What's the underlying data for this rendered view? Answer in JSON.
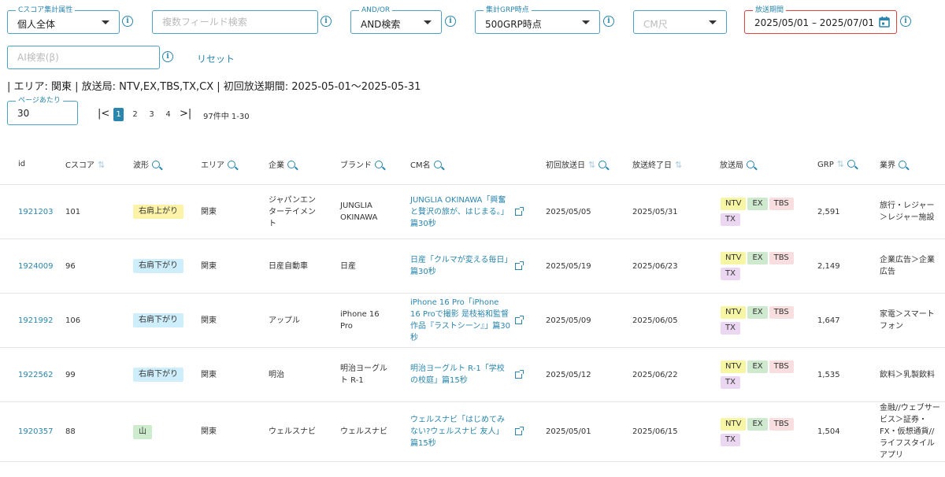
{
  "filters": {
    "score_attr": {
      "label": "Cスコア集計属性",
      "value": "個人全体"
    },
    "multi_search": {
      "placeholder": "複数フィールド検索"
    },
    "and_or": {
      "label": "AND/OR",
      "value": "AND検索"
    },
    "grp_point": {
      "label": "集計GRP時点",
      "value": "500GRP時点"
    },
    "cm_length": {
      "placeholder": "CM尺"
    },
    "period": {
      "label": "放送期間",
      "value": "2025/05/01 – 2025/07/01"
    },
    "ai_search": {
      "placeholder": "AI検索(β)"
    },
    "reset_label": "リセット",
    "info_glyph": "i"
  },
  "filter_summary": "| エリア: 関東 | 放送局: NTV,EX,TBS,TX,CX | 初回放送期間: 2025-05-01〜2025-05-31",
  "pagination": {
    "per_page_label": "ページあたり",
    "per_page_value": "30",
    "first_glyph": "|<",
    "last_glyph": ">|",
    "pages": [
      "1",
      "2",
      "3",
      "4"
    ],
    "active_page": "1",
    "info": "97件中 1-30"
  },
  "table": {
    "headers": {
      "id": "id",
      "cscore": "Cスコア",
      "shape": "波形",
      "area": "エリア",
      "company": "企業",
      "brand": "ブランド",
      "cm": "CM名",
      "first_air": "初回放送日",
      "last_air": "放送終了日",
      "station": "放送局",
      "grp": "GRP",
      "industry": "業界"
    },
    "sort_glyph": "⇅",
    "rows": [
      {
        "id": "1921203",
        "cscore": "101",
        "shape": "右肩上がり",
        "shape_type": "up",
        "area": "関東",
        "company": "ジャパンエンターテイメント",
        "brand": "JUNGLIA OKINAWA",
        "cm": "JUNGLIA OKINAWA「興奮と贅沢の旅が、はじまる。」篇30秒",
        "first_air": "2025/05/05",
        "last_air": "2025/05/31",
        "stations": [
          "NTV",
          "EX",
          "TBS",
          "TX"
        ],
        "grp": "2,591",
        "industry": "旅行・レジャー＞レジャー施設"
      },
      {
        "id": "1924009",
        "cscore": "96",
        "shape": "右肩下がり",
        "shape_type": "down",
        "area": "関東",
        "company": "日産自動車",
        "brand": "日産",
        "cm": "日産「クルマが変える毎日」篇30秒",
        "first_air": "2025/05/19",
        "last_air": "2025/06/23",
        "stations": [
          "NTV",
          "EX",
          "TBS",
          "TX"
        ],
        "grp": "2,149",
        "industry": "企業広告＞企業広告"
      },
      {
        "id": "1921992",
        "cscore": "106",
        "shape": "右肩下がり",
        "shape_type": "down",
        "area": "関東",
        "company": "アップル",
        "brand": "iPhone 16 Pro",
        "cm": "iPhone 16 Pro「iPhone 16 Proで撮影 是枝裕和監督作品『ラストシーン』」篇30秒",
        "first_air": "2025/05/09",
        "last_air": "2025/06/05",
        "stations": [
          "NTV",
          "EX",
          "TBS",
          "TX"
        ],
        "grp": "1,647",
        "industry": "家電＞スマートフォン"
      },
      {
        "id": "1922562",
        "cscore": "99",
        "shape": "右肩下がり",
        "shape_type": "down",
        "area": "関東",
        "company": "明治",
        "brand": "明治ヨーグルト R-1",
        "cm": "明治ヨーグルト R-1「学校の校庭」篇15秒",
        "first_air": "2025/05/12",
        "last_air": "2025/06/22",
        "stations": [
          "NTV",
          "EX",
          "TBS",
          "TX"
        ],
        "grp": "1,535",
        "industry": "飲料＞乳製飲料"
      },
      {
        "id": "1920357",
        "cscore": "88",
        "shape": "山",
        "shape_type": "mtn",
        "area": "関東",
        "company": "ウェルスナビ",
        "brand": "ウェルスナビ",
        "cm": "ウェルスナビ「はじめてみない?ウェルスナビ 友人」篇15秒",
        "first_air": "2025/05/01",
        "last_air": "2025/06/15",
        "stations": [
          "NTV",
          "EX",
          "TBS",
          "TX"
        ],
        "grp": "1,504",
        "industry": "金融//ウェブサービス＞証券・FX・仮想通貨//ライフスタイルアプリ"
      }
    ]
  },
  "colors": {
    "accent": "#2a86ad",
    "error_border": "#e04040"
  }
}
